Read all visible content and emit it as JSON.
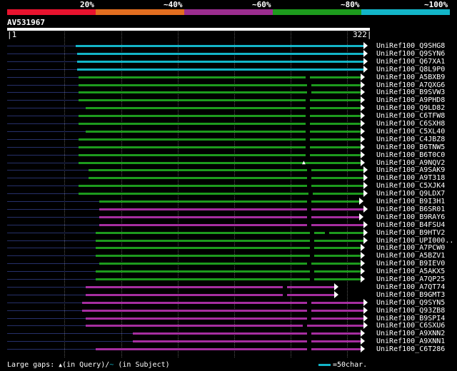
{
  "legend": {
    "segments": [
      {
        "label": "20%",
        "color": "#e8132e"
      },
      {
        "label": "~40%",
        "color": "#e26e20"
      },
      {
        "label": "~60%",
        "color": "#9b2d8f"
      },
      {
        "label": "~80%",
        "color": "#1d9b1d"
      },
      {
        "label": "~100%",
        "color": "#13b5c8"
      }
    ]
  },
  "query": {
    "title": "AV531967",
    "start": "1",
    "end": "322"
  },
  "colors": {
    "lead": "#26306a",
    "cyan": "#13b5c8",
    "green": "#1d9b1d",
    "magenta": "#a62ea0",
    "arrow": "#ffffff"
  },
  "hits": [
    {
      "label": "UniRef100_Q9SHG8",
      "color": "cyan"
    },
    {
      "label": "UniRef100_Q9SYN6",
      "color": "cyan"
    },
    {
      "label": "UniRef100_Q67XA1",
      "color": "cyan"
    },
    {
      "label": "UniRef100_Q8L9P0",
      "color": "cyan"
    },
    {
      "label": "UniRef100_A5BXB9",
      "color": "green"
    },
    {
      "label": "UniRef100_A7QXG6",
      "color": "green"
    },
    {
      "label": "UniRef100_B9SVW3",
      "color": "green"
    },
    {
      "label": "UniRef100_A9PHD8",
      "color": "green"
    },
    {
      "label": "UniRef100_Q9LD82",
      "color": "green"
    },
    {
      "label": "UniRef100_C6TFW8",
      "color": "green"
    },
    {
      "label": "UniRef100_C6SXH8",
      "color": "green"
    },
    {
      "label": "UniRef100_C5XL40",
      "color": "green"
    },
    {
      "label": "UniRef100_C4JBZ8",
      "color": "green"
    },
    {
      "label": "UniRef100_B6TNW5",
      "color": "green"
    },
    {
      "label": "UniRef100_B6T0C0",
      "color": "green"
    },
    {
      "label": "UniRef100_A9NQV2",
      "color": "green"
    },
    {
      "label": "UniRef100_A9SAK9",
      "color": "green"
    },
    {
      "label": "UniRef100_A9T318",
      "color": "green"
    },
    {
      "label": "UniRef100_C5XJK4",
      "color": "green"
    },
    {
      "label": "UniRef100_Q9LDX7",
      "color": "green"
    },
    {
      "label": "UniRef100_B9I3H1",
      "color": "green"
    },
    {
      "label": "UniRef100_B6SR01",
      "color": "magenta"
    },
    {
      "label": "UniRef100_B9RAY6",
      "color": "magenta"
    },
    {
      "label": "UniRef100_B4FSU4",
      "color": "magenta"
    },
    {
      "label": "UniRef100_B9HTV2",
      "color": "green"
    },
    {
      "label": "UniRef100_UPI000..",
      "color": "green"
    },
    {
      "label": "UniRef100_A7PCW0",
      "color": "green"
    },
    {
      "label": "UniRef100_A5BZV1",
      "color": "green"
    },
    {
      "label": "UniRef100_B9IEV0",
      "color": "green"
    },
    {
      "label": "UniRef100_A5AKX5",
      "color": "green"
    },
    {
      "label": "UniRef100_A7QP25",
      "color": "green"
    },
    {
      "label": "UniRef100_A7QT74",
      "color": "magenta"
    },
    {
      "label": "UniRef100_B9GMT3",
      "color": "magenta"
    },
    {
      "label": "UniRef100_Q9SYN5",
      "color": "magenta"
    },
    {
      "label": "UniRef100_Q93ZB8",
      "color": "magenta"
    },
    {
      "label": "UniRef100_B9SPI4",
      "color": "magenta"
    },
    {
      "label": "UniRef100_C6SXU6",
      "color": "magenta"
    },
    {
      "label": "UniRef100_A9XNN2",
      "color": "magenta"
    },
    {
      "label": "UniRef100_A9XNN1",
      "color": "magenta"
    },
    {
      "label": "UniRef100_C6T286",
      "color": "magenta"
    }
  ],
  "footer": {
    "gaps_prefix": "Large gaps:",
    "gaps_query_symbol": "▲",
    "gaps_query_text": "(in Query)/",
    "gaps_subject_symbol": "~",
    "gaps_subject_text": " (in Subject)",
    "scale_label": "=50char."
  }
}
